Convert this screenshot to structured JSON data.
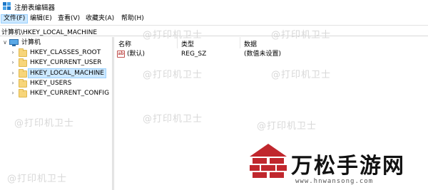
{
  "window": {
    "title": "注册表编辑器"
  },
  "menu": [
    {
      "label": "文件(F)",
      "active": true
    },
    {
      "label": "编辑(E)",
      "active": false
    },
    {
      "label": "查看(V)",
      "active": false
    },
    {
      "label": "收藏夹(A)",
      "active": false
    },
    {
      "label": "帮助(H)",
      "active": false
    }
  ],
  "address": {
    "path": "计算机\\HKEY_LOCAL_MACHINE"
  },
  "tree": {
    "root": {
      "label": "计算机",
      "expanded": true,
      "icon": "computer-icon"
    },
    "items": [
      {
        "label": "HKEY_CLASSES_ROOT",
        "selected": false,
        "icon": "folder-icon"
      },
      {
        "label": "HKEY_CURRENT_USER",
        "selected": false,
        "icon": "folder-icon"
      },
      {
        "label": "HKEY_LOCAL_MACHINE",
        "selected": true,
        "icon": "folder-icon"
      },
      {
        "label": "HKEY_USERS",
        "selected": false,
        "icon": "folder-icon"
      },
      {
        "label": "HKEY_CURRENT_CONFIG",
        "selected": false,
        "icon": "folder-icon"
      }
    ]
  },
  "list": {
    "columns": [
      "名称",
      "类型",
      "数据"
    ],
    "rows": [
      {
        "icon_text": "ab",
        "name": "(默认)",
        "type": "REG_SZ",
        "data": "(数值未设置)"
      }
    ]
  },
  "watermarks": [
    "@打印机卫士",
    "@打印机卫士",
    "@打印机卫士",
    "@打印机卫士",
    "@打印机卫士",
    "@打印机卫士",
    "@打印机卫士",
    "@打印机卫士"
  ],
  "brand": {
    "name": "万松手游网",
    "url": "www.hnwansong.com",
    "colors": {
      "red": "#c0272d",
      "dark": "#111111"
    }
  }
}
